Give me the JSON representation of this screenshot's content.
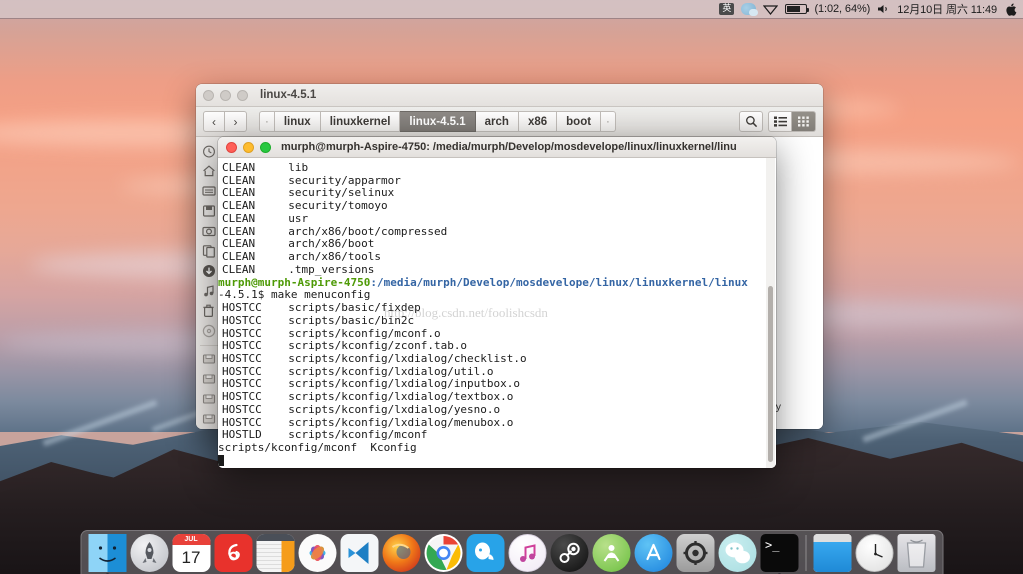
{
  "menubar": {
    "ime_label": "英",
    "battery_text": "(1:02, 64%)",
    "datetime": "12月10日 周六 11:49",
    "apple_logo": "",
    "icons": [
      "ime-icon",
      "wechat-icon",
      "wifi-icon",
      "battery-icon",
      "volume-icon",
      "apple-menu-icon"
    ]
  },
  "file_manager": {
    "title": "linux-4.5.1",
    "nav": {
      "back": "‹",
      "forward": "›"
    },
    "breadcrumbs": [
      {
        "label": "·",
        "active": false
      },
      {
        "label": "linux",
        "active": false
      },
      {
        "label": "linuxkernel",
        "active": false
      },
      {
        "label": "linux-4.5.1",
        "active": true
      },
      {
        "label": "arch",
        "active": false
      },
      {
        "label": "x86",
        "active": false
      },
      {
        "label": "boot",
        "active": false
      },
      {
        "label": "·",
        "active": false
      }
    ],
    "toolbar": {
      "search_label": "search-icon",
      "list_view_label": "list-view-icon",
      "grid_view_label": "grid-view-icon",
      "active_view": "grid"
    },
    "sidebar_items": [
      "recent-icon",
      "home-icon",
      "desktop-icon",
      "documents-icon",
      "pictures-icon",
      "files-icon",
      "downloads-icon",
      "music-icon",
      "trash-icon",
      "disc-icon",
      "drive-1-icon",
      "drive-2-icon",
      "drive-3-icon",
      "drive-4-icon"
    ],
    "visible_file": "-py"
  },
  "terminal": {
    "title": "murph@murph-Aspire-4750: /media/murph/Develop/mosdevelope/linux/linuxkernel/linu",
    "watermark": "http://blog.csdn.net/foolishcsdn",
    "prompt_user": "murph@murph-Aspire-4750",
    "prompt_path": ":/media/murph/Develop/mosdevelope/linux/linuxkernel/linux",
    "prompt_continuation": "-4.5.1$ make menuconfig",
    "lines": [
      {
        "tag": "CLEAN",
        "target": "lib"
      },
      {
        "tag": "CLEAN",
        "target": "security/apparmor"
      },
      {
        "tag": "CLEAN",
        "target": "security/selinux"
      },
      {
        "tag": "CLEAN",
        "target": "security/tomoyo"
      },
      {
        "tag": "CLEAN",
        "target": "usr"
      },
      {
        "tag": "CLEAN",
        "target": "arch/x86/boot/compressed"
      },
      {
        "tag": "CLEAN",
        "target": "arch/x86/boot"
      },
      {
        "tag": "CLEAN",
        "target": "arch/x86/tools"
      },
      {
        "tag": "CLEAN",
        "target": ".tmp_versions"
      }
    ],
    "build_lines": [
      {
        "tag": "HOSTCC",
        "target": "scripts/basic/fixdep"
      },
      {
        "tag": "HOSTCC",
        "target": "scripts/basic/bin2c"
      },
      {
        "tag": "HOSTCC",
        "target": "scripts/kconfig/mconf.o"
      },
      {
        "tag": "HOSTCC",
        "target": "scripts/kconfig/zconf.tab.o"
      },
      {
        "tag": "HOSTCC",
        "target": "scripts/kconfig/lxdialog/checklist.o"
      },
      {
        "tag": "HOSTCC",
        "target": "scripts/kconfig/lxdialog/util.o"
      },
      {
        "tag": "HOSTCC",
        "target": "scripts/kconfig/lxdialog/inputbox.o"
      },
      {
        "tag": "HOSTCC",
        "target": "scripts/kconfig/lxdialog/textbox.o"
      },
      {
        "tag": "HOSTCC",
        "target": "scripts/kconfig/lxdialog/yesno.o"
      },
      {
        "tag": "HOSTCC",
        "target": "scripts/kconfig/lxdialog/menubox.o"
      },
      {
        "tag": "HOSTLD",
        "target": "scripts/kconfig/mconf"
      }
    ],
    "final_line": "scripts/kconfig/mconf  Kconfig"
  },
  "dock": {
    "items": [
      {
        "name": "finder-icon",
        "label": "Finder",
        "running": true
      },
      {
        "name": "launchpad-icon",
        "label": "Launchpad",
        "running": false
      },
      {
        "name": "calendar-icon",
        "label": "Calendar",
        "running": false,
        "month": "JUL",
        "day": "17"
      },
      {
        "name": "netease-music-icon",
        "label": "NetEase Music",
        "running": false
      },
      {
        "name": "numbers-icon",
        "label": "Numbers",
        "running": false
      },
      {
        "name": "photos-icon",
        "label": "Photos",
        "running": false
      },
      {
        "name": "vscode-icon",
        "label": "Visual Studio Code",
        "running": false
      },
      {
        "name": "firefox-icon",
        "label": "Firefox",
        "running": false
      },
      {
        "name": "chrome-icon",
        "label": "Google Chrome",
        "running": false
      },
      {
        "name": "qq-icon",
        "label": "QQ",
        "running": false
      },
      {
        "name": "itunes-icon",
        "label": "iTunes",
        "running": false
      },
      {
        "name": "steam-icon",
        "label": "Steam",
        "running": false
      },
      {
        "name": "android-studio-icon",
        "label": "Android Studio",
        "running": false
      },
      {
        "name": "app-store-icon",
        "label": "App Store",
        "running": false
      },
      {
        "name": "system-preferences-icon",
        "label": "System Preferences",
        "running": false
      },
      {
        "name": "wechat-icon",
        "label": "WeChat",
        "running": false
      },
      {
        "name": "terminal-icon",
        "label": "Terminal",
        "running": true
      }
    ],
    "right_items": [
      {
        "name": "finder-window-icon",
        "label": "Finder Window"
      },
      {
        "name": "clock-icon",
        "label": "Clock"
      },
      {
        "name": "trash-icon",
        "label": "Trash"
      }
    ]
  },
  "colors": {
    "prompt_green": "#4e9a06",
    "prompt_blue": "#3465a4",
    "crumb_active": "#7d7975"
  }
}
